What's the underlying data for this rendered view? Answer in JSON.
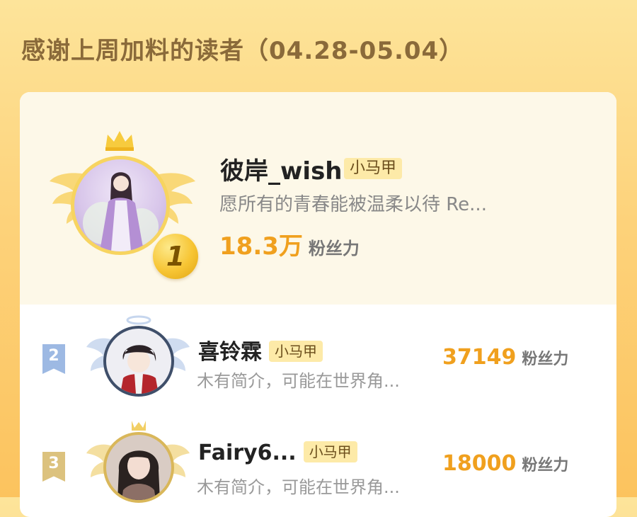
{
  "header": {
    "title": "感谢上周加料的读者（04.28-05.04）"
  },
  "top_reader": {
    "rank": "1",
    "name": "彼岸_wish",
    "badge": "小马甲",
    "bio": "愿所有的青春能被温柔以待 Re...",
    "fans_value": "18.3万",
    "fans_label": "粉丝力"
  },
  "readers": [
    {
      "rank": "2",
      "name": "喜铃霖",
      "badge": "小马甲",
      "bio": "木有简介，可能在世界角...",
      "fans_value": "37149",
      "fans_label": "粉丝力"
    },
    {
      "rank": "3",
      "name": "Fairy6...",
      "badge": "小马甲",
      "bio": "木有简介，可能在世界角...",
      "fans_value": "18000",
      "fans_label": "粉丝力"
    }
  ],
  "icons": {
    "crown": "crown-icon",
    "wings": "wings-icon",
    "rank_coin": "gold-medal-icon",
    "rank_ribbon": "rank-ribbon-icon"
  },
  "colors": {
    "accent": "#f0a01e",
    "title": "#8a6a3a",
    "badge_bg": "#fdeaa8",
    "silver": "#9db9e3",
    "bronze": "#dcc27e"
  }
}
